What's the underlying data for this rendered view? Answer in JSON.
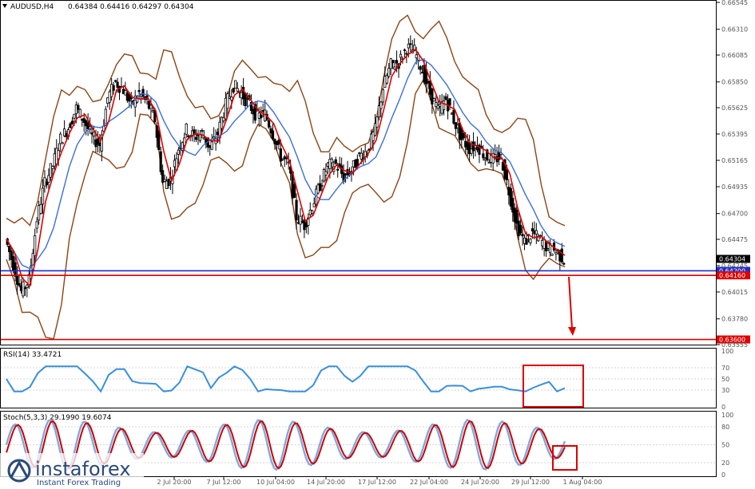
{
  "header": {
    "symbol": "AUDUSD,H4",
    "ohlc": "0.64384 0.64416 0.64297 0.64304"
  },
  "price_axis": {
    "labels": [
      "0.66545",
      "0.66310",
      "0.66085",
      "0.65850",
      "0.65625",
      "0.65395",
      "0.65165",
      "0.64935",
      "0.64700",
      "0.64475",
      "0.64245",
      "0.64015",
      "0.63780",
      "0.63555"
    ],
    "current_price": "0.64304",
    "level_blue": "0.64200",
    "level_red_1": "0.64160",
    "level_red_2": "0.63600"
  },
  "rsi_panel": {
    "label": "RSI(14) 33.4721",
    "levels": [
      "100",
      "70",
      "50",
      "30",
      "0"
    ]
  },
  "stoch_panel": {
    "label": "Stoch(5,3,3) 29.1990 19.6074",
    "levels": [
      "100",
      "80",
      "50",
      "20",
      "0"
    ]
  },
  "time_axis": [
    "2 Jul 20:00",
    "7 Jul 12:00",
    "10 Jul 04:00",
    "14 Jul 20:00",
    "17 Jul 12:00",
    "22 Jul 04:00",
    "24 Jul 20:00",
    "29 Jul 12:00",
    "1 Aug 04:00"
  ],
  "watermark": {
    "brand": "instaforex",
    "tagline": "Instant Forex Trading"
  },
  "colors": {
    "candles": "#000000",
    "ma_fast": "#dd0000",
    "ma_slow": "#3a6fd8",
    "bands": "#8b4513",
    "rsi_line": "#3a8fdc",
    "stoch_main": "#7fa8e0",
    "stoch_signal": "#cc0000",
    "annotation": "#dd0000"
  },
  "chart_data": {
    "type": "candlestick",
    "symbol": "AUDUSD",
    "timeframe": "H4",
    "ylim": [
      0.63555,
      0.66545
    ],
    "close_path": [
      {
        "x": "29 Jun 20:00",
        "y": 0.6448
      },
      {
        "x": "30 Jun 04:00",
        "y": 0.6425
      },
      {
        "x": "30 Jun 12:00",
        "y": 0.6402
      },
      {
        "x": "30 Jun 20:00",
        "y": 0.6412
      },
      {
        "x": "1 Jul 04:00",
        "y": 0.6465
      },
      {
        "x": "1 Jul 12:00",
        "y": 0.6497
      },
      {
        "x": "1 Jul 20:00",
        "y": 0.6512
      },
      {
        "x": "2 Jul 04:00",
        "y": 0.6535
      },
      {
        "x": "2 Jul 12:00",
        "y": 0.6545
      },
      {
        "x": "2 Jul 20:00",
        "y": 0.6562
      },
      {
        "x": "3 Jul 04:00",
        "y": 0.6551
      },
      {
        "x": "3 Jul 12:00",
        "y": 0.6537
      },
      {
        "x": "3 Jul 20:00",
        "y": 0.653
      },
      {
        "x": "6 Jul 04:00",
        "y": 0.6571
      },
      {
        "x": "6 Jul 12:00",
        "y": 0.6585
      },
      {
        "x": "6 Jul 20:00",
        "y": 0.6578
      },
      {
        "x": "7 Jul 04:00",
        "y": 0.6565
      },
      {
        "x": "7 Jul 12:00",
        "y": 0.6575
      },
      {
        "x": "7 Jul 20:00",
        "y": 0.6567
      },
      {
        "x": "8 Jul 04:00",
        "y": 0.6552
      },
      {
        "x": "8 Jul 12:00",
        "y": 0.6497
      },
      {
        "x": "8 Jul 20:00",
        "y": 0.65
      },
      {
        "x": "9 Jul 04:00",
        "y": 0.6527
      },
      {
        "x": "9 Jul 12:00",
        "y": 0.6543
      },
      {
        "x": "9 Jul 20:00",
        "y": 0.6537
      },
      {
        "x": "10 Jul 04:00",
        "y": 0.654
      },
      {
        "x": "10 Jul 12:00",
        "y": 0.6527
      },
      {
        "x": "10 Jul 20:00",
        "y": 0.654
      },
      {
        "x": "13 Jul 04:00",
        "y": 0.6565
      },
      {
        "x": "13 Jul 12:00",
        "y": 0.6582
      },
      {
        "x": "13 Jul 20:00",
        "y": 0.6575
      },
      {
        "x": "14 Jul 04:00",
        "y": 0.6565
      },
      {
        "x": "14 Jul 12:00",
        "y": 0.6555
      },
      {
        "x": "14 Jul 20:00",
        "y": 0.6557
      },
      {
        "x": "15 Jul 04:00",
        "y": 0.654
      },
      {
        "x": "15 Jul 12:00",
        "y": 0.652
      },
      {
        "x": "15 Jul 20:00",
        "y": 0.6512
      },
      {
        "x": "16 Jul 04:00",
        "y": 0.6467
      },
      {
        "x": "16 Jul 12:00",
        "y": 0.646
      },
      {
        "x": "16 Jul 20:00",
        "y": 0.6477
      },
      {
        "x": "17 Jul 04:00",
        "y": 0.6495
      },
      {
        "x": "17 Jul 12:00",
        "y": 0.6512
      },
      {
        "x": "17 Jul 20:00",
        "y": 0.6513
      },
      {
        "x": "20 Jul 04:00",
        "y": 0.6502
      },
      {
        "x": "20 Jul 12:00",
        "y": 0.6508
      },
      {
        "x": "20 Jul 20:00",
        "y": 0.652
      },
      {
        "x": "21 Jul 04:00",
        "y": 0.6525
      },
      {
        "x": "21 Jul 12:00",
        "y": 0.6543
      },
      {
        "x": "21 Jul 20:00",
        "y": 0.658
      },
      {
        "x": "22 Jul 04:00",
        "y": 0.66
      },
      {
        "x": "22 Jul 12:00",
        "y": 0.6602
      },
      {
        "x": "22 Jul 20:00",
        "y": 0.6615
      },
      {
        "x": "23 Jul 04:00",
        "y": 0.6612
      },
      {
        "x": "23 Jul 12:00",
        "y": 0.6595
      },
      {
        "x": "23 Jul 20:00",
        "y": 0.6575
      },
      {
        "x": "24 Jul 04:00",
        "y": 0.656
      },
      {
        "x": "24 Jul 12:00",
        "y": 0.657
      },
      {
        "x": "24 Jul 20:00",
        "y": 0.6552
      },
      {
        "x": "27 Jul 04:00",
        "y": 0.6535
      },
      {
        "x": "27 Jul 12:00",
        "y": 0.6527
      },
      {
        "x": "27 Jul 20:00",
        "y": 0.653
      },
      {
        "x": "28 Jul 04:00",
        "y": 0.652
      },
      {
        "x": "28 Jul 12:00",
        "y": 0.6517
      },
      {
        "x": "28 Jul 20:00",
        "y": 0.652
      },
      {
        "x": "29 Jul 04:00",
        "y": 0.649
      },
      {
        "x": "29 Jul 12:00",
        "y": 0.646
      },
      {
        "x": "29 Jul 20:00",
        "y": 0.6445
      },
      {
        "x": "30 Jul 04:00",
        "y": 0.6453
      },
      {
        "x": "30 Jul 12:00",
        "y": 0.6447
      },
      {
        "x": "30 Jul 20:00",
        "y": 0.644
      },
      {
        "x": "31 Jul 04:00",
        "y": 0.6437
      },
      {
        "x": "31 Jul 12:00",
        "y": 0.643
      }
    ],
    "horizontal_levels": [
      {
        "value": 0.642,
        "color": "#1a2fd0"
      },
      {
        "value": 0.6416,
        "color": "#dd0000"
      },
      {
        "value": 0.636,
        "color": "#dd0000"
      }
    ],
    "indicators": {
      "rsi_period": 14,
      "rsi_last": 33.4721,
      "stoch_params": "5,3,3",
      "stoch_main_last": 29.199,
      "stoch_signal_last": 19.6074
    }
  }
}
